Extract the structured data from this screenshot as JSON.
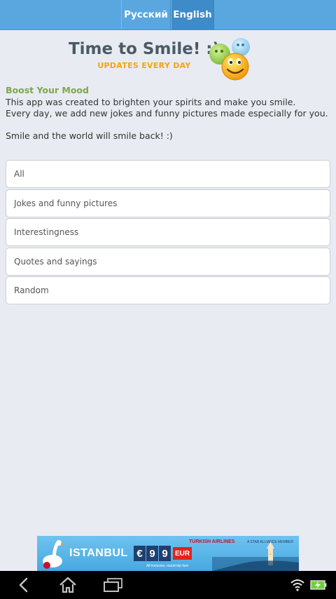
{
  "languages": {
    "russian": "Русский",
    "english": "English",
    "selected": "English"
  },
  "header": {
    "title": "Time to Smile! :)",
    "subtitle": "UPDATES EVERY DAY"
  },
  "intro": {
    "heading": "Boost Your Mood",
    "line1": "This app was created to brighten your spirits and make you smile.",
    "line2": "Every day, we add new jokes and funny pictures made especially for you.",
    "line3": "Smile and the world will smile back! :)"
  },
  "categories": [
    "All",
    "Jokes and funny pictures",
    "Interestingness",
    "Quotes and sayings",
    "Random"
  ],
  "ad": {
    "city": "ISTANBUL",
    "price_prefix": "€",
    "price_digit1": "9",
    "price_digit2": "9",
    "currency": "EUR",
    "airline": "TURKISH AIRLINES",
    "alliance": "A STAR ALLIANCE MEMBER",
    "note": "All inclusive, round trip fare"
  },
  "colors": {
    "top_bar": "#5aa7e0",
    "selected_language": "#3d8bc8",
    "title": "#4b5a66",
    "subtitle": "#f4a50a",
    "heading": "#7fa64a",
    "background": "#e8ecf2"
  },
  "icons": {
    "logo": "smiley-faces-icon",
    "back": "back-icon",
    "home": "home-icon",
    "recent_apps": "recent-apps-icon",
    "wifi": "wifi-icon",
    "battery": "battery-charging-icon"
  }
}
